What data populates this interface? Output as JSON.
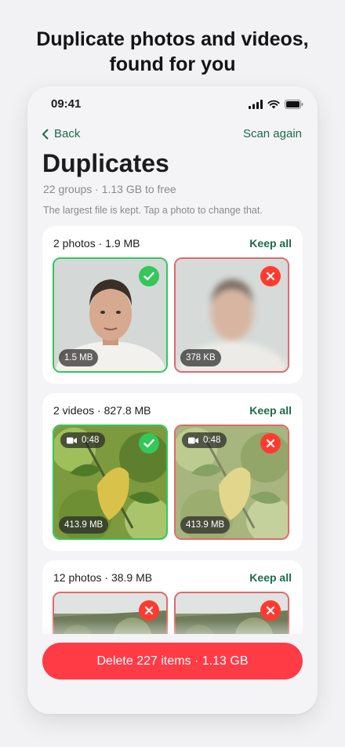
{
  "headline": {
    "line1": "Duplicate photos and videos,",
    "line2": "found for you"
  },
  "status_bar": {
    "time": "09:41",
    "icons": [
      "cellular-signal-icon",
      "wifi-icon",
      "battery-icon"
    ]
  },
  "nav": {
    "back_label": "Back",
    "scan_again_label": "Scan again"
  },
  "page": {
    "title": "Duplicates",
    "subtitle": "22 groups · 1.13 GB to free",
    "hint": "The largest file is kept. Tap a photo to change that."
  },
  "groups": [
    {
      "label": "2 photos · 1.9 MB",
      "keep_all": "Keep all",
      "items": [
        {
          "size": "1.5 MB",
          "status": "keep"
        },
        {
          "size": "378 KB",
          "status": "delete"
        }
      ]
    },
    {
      "label": "2 videos · 827.8 MB",
      "keep_all": "Keep all",
      "items": [
        {
          "size": "413.9 MB",
          "duration": "0:48",
          "status": "keep"
        },
        {
          "size": "413.9 MB",
          "duration": "0:48",
          "status": "delete"
        }
      ]
    },
    {
      "label": "12 photos · 38.9 MB",
      "keep_all": "Keep all",
      "items": [
        {
          "status": "delete"
        },
        {
          "status": "delete"
        }
      ]
    }
  ],
  "delete_button": {
    "label": "Delete 227 items · 1.13 GB"
  },
  "colors": {
    "accent_green": "#1d6b4a",
    "keep_check": "#34c759",
    "delete_red": "#ff3b30",
    "delete_button": "#ff3b46"
  }
}
